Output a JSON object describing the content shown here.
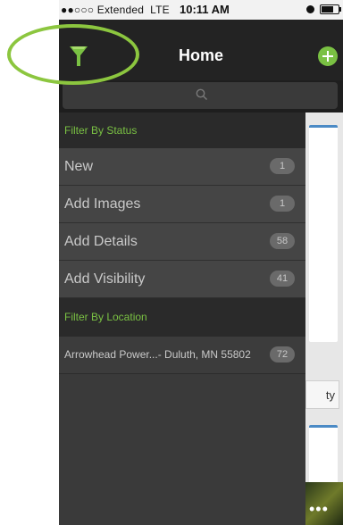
{
  "status_bar": {
    "carrier": "●●○○○ Extended",
    "network": "LTE",
    "time": "10:11 AM"
  },
  "nav": {
    "title": "Home"
  },
  "search": {
    "placeholder": ""
  },
  "filters": {
    "status_header": "Filter By Status",
    "status_items": [
      {
        "label": "New",
        "count": "1"
      },
      {
        "label": "Add Images",
        "count": "1"
      },
      {
        "label": "Add Details",
        "count": "58"
      },
      {
        "label": "Add Visibility",
        "count": "41"
      }
    ],
    "location_header": "Filter By Location",
    "location_items": [
      {
        "label": "Arrowhead Power...- Duluth, MN 55802",
        "count": "72"
      }
    ]
  },
  "background": {
    "button_label": "ty",
    "more": "•••"
  },
  "colors": {
    "accent_green": "#7ac143",
    "nav_background": "#232323",
    "drawer_background": "#3a3a3a",
    "highlight_ring": "#8cc63f"
  },
  "icons": [
    "filter-icon",
    "add-icon",
    "search-icon",
    "alarm-icon",
    "battery-icon",
    "more-icon"
  ]
}
